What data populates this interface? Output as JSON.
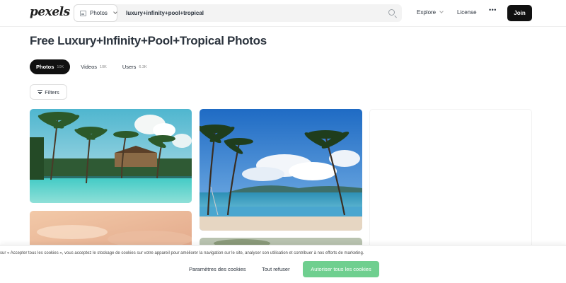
{
  "header": {
    "logo": "pexels",
    "search": {
      "type_label": "Photos",
      "query": "luxury+infinity+pool+tropical"
    },
    "nav": {
      "explore": "Explore",
      "license": "License",
      "more": "•••",
      "join": "Join"
    }
  },
  "main": {
    "title": "Free Luxury+Infinity+Pool+Tropical Photos",
    "tabs": [
      {
        "label": "Photos",
        "count": "10K",
        "active": true
      },
      {
        "label": "Videos",
        "count": "10K",
        "active": false
      },
      {
        "label": "Users",
        "count": "6.3K",
        "active": false
      }
    ],
    "filters_label": "Filters"
  },
  "cookie_banner": {
    "text": "sur « Accepter tous les cookies », vous acceptez le stockage de cookies sur votre appareil pour améliorer la navigation sur le site, analyser son utilisation et contribuer à nos efforts de marketing.",
    "settings_label": "Paramètres des cookies",
    "refuse_label": "Tout refuser",
    "accept_label": "Autoriser tous les cookies",
    "accept_color": "#6fcf8f"
  },
  "colors": {
    "text": "#2c343e",
    "join_button": "#111111",
    "active_tab": "#111111"
  }
}
